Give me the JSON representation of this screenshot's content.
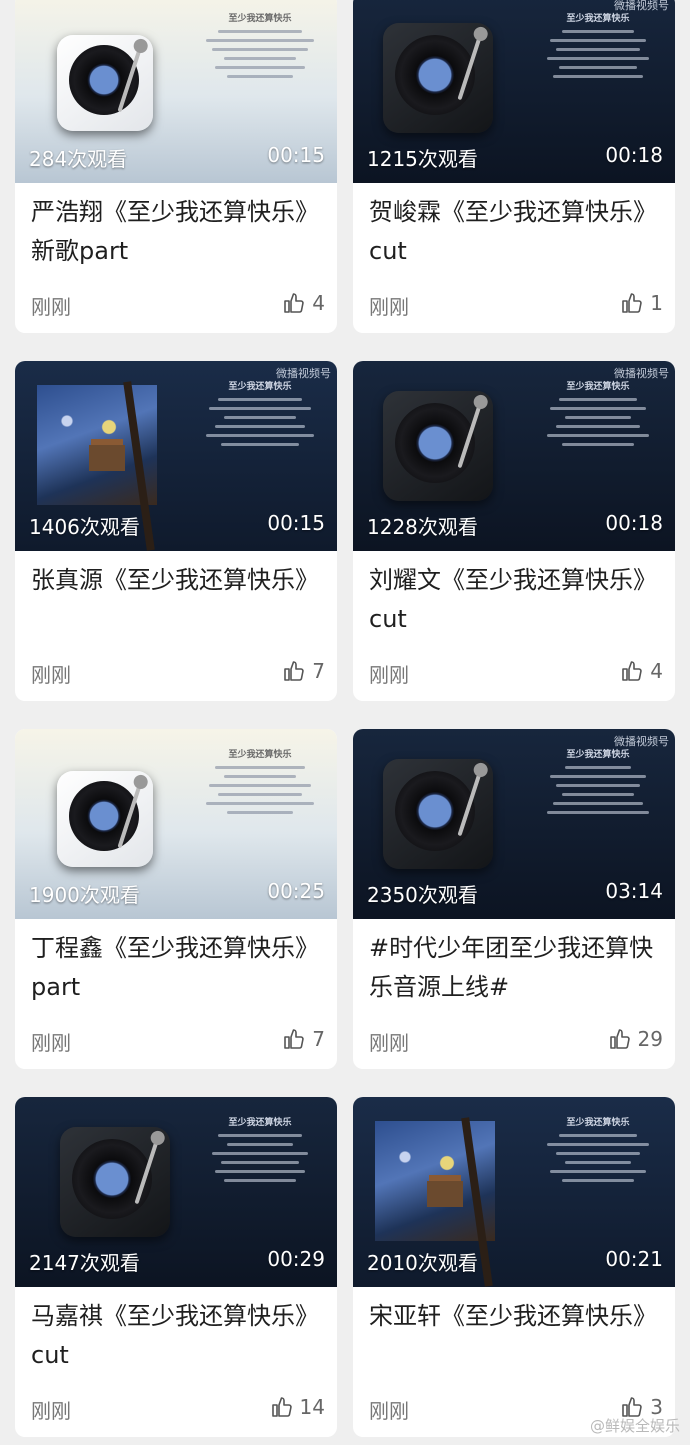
{
  "feed": {
    "cards": [
      {
        "theme": "light",
        "title": "严浩翔《至少我还算快乐》新歌part",
        "views": "284次观看",
        "duration": "00:15",
        "time": "刚刚",
        "likes": "4",
        "lyric_title": "至少我还算快乐"
      },
      {
        "theme": "dark",
        "title": "贺峻霖《至少我还算快乐》cut",
        "views": "1215次观看",
        "duration": "00:18",
        "time": "刚刚",
        "likes": "1",
        "lyric_title": "至少我还算快乐",
        "badge": "微播视频号"
      },
      {
        "theme": "art",
        "title": "张真源《至少我还算快乐》",
        "views": "1406次观看",
        "duration": "00:15",
        "time": "刚刚",
        "likes": "7",
        "lyric_title": "至少我还算快乐",
        "badge": "微播视频号"
      },
      {
        "theme": "dark",
        "title": "刘耀文《至少我还算快乐》cut",
        "views": "1228次观看",
        "duration": "00:18",
        "time": "刚刚",
        "likes": "4",
        "lyric_title": "至少我还算快乐",
        "badge": "微播视频号"
      },
      {
        "theme": "light",
        "title": "丁程鑫《至少我还算快乐》part",
        "views": "1900次观看",
        "duration": "00:25",
        "time": "刚刚",
        "likes": "7",
        "lyric_title": "至少我还算快乐"
      },
      {
        "theme": "dark",
        "title": "#时代少年团至少我还算快乐音源上线#",
        "views": "2350次观看",
        "duration": "03:14",
        "time": "刚刚",
        "likes": "29",
        "lyric_title": "至少我还算快乐",
        "badge": "微播视频号"
      },
      {
        "theme": "dark",
        "title": "马嘉祺《至少我还算快乐》cut",
        "views": "2147次观看",
        "duration": "00:29",
        "time": "刚刚",
        "likes": "14",
        "lyric_title": "至少我还算快乐"
      },
      {
        "theme": "art",
        "title": "宋亚轩《至少我还算快乐》",
        "views": "2010次观看",
        "duration": "00:21",
        "time": "刚刚",
        "likes": "3",
        "lyric_title": "至少我还算快乐"
      }
    ]
  },
  "watermark": "@鲜娱全娱乐",
  "colors": {
    "card_bg": "#ffffff",
    "page_bg": "#efefef",
    "title_text": "#1f1f1f",
    "meta_text": "#777777"
  }
}
